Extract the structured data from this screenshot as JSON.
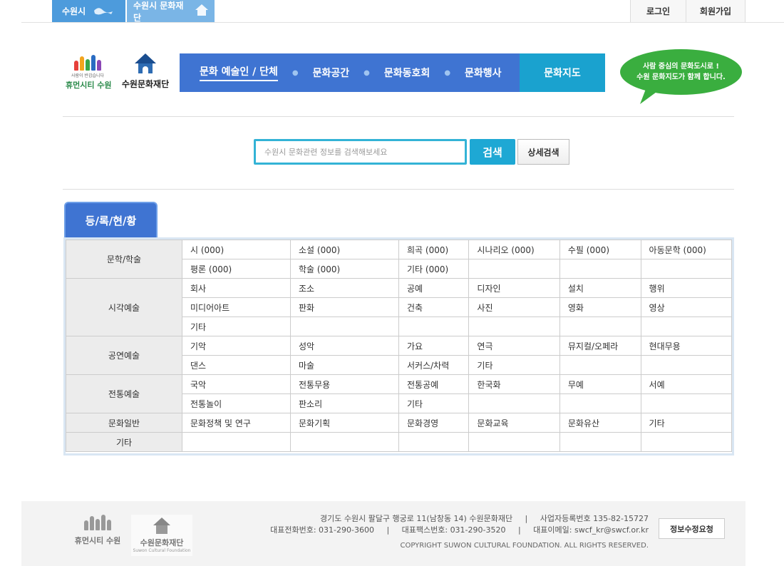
{
  "topbar": {
    "links": [
      {
        "label": "수원시",
        "icon": "map-icon"
      },
      {
        "label": "수원시 문화재단",
        "icon": "home-icon"
      }
    ],
    "login": "로그인",
    "join": "회원가입"
  },
  "header": {
    "logo1": {
      "small": "사람이 반갑습니다",
      "name": "휴먼시티 수원"
    },
    "logo2": {
      "name": "수원문화재단"
    },
    "gnb": [
      {
        "label": "문화 예술인 / 단체"
      },
      {
        "label": "문화공간"
      },
      {
        "label": "문화동호회"
      },
      {
        "label": "문화행사"
      }
    ],
    "map_menu": "문화지도",
    "bubble_line1": "사람 중심의 문화도시로 !",
    "bubble_line2": "수원 문화지도가 함께 합니다."
  },
  "search": {
    "placeholder": "수원시 문화관련 정보를 검색해보세요",
    "value": "",
    "button": "검색",
    "detail_button": "상세검색"
  },
  "registration": {
    "tab": "등/록/현/황",
    "rows": [
      {
        "category": "문학/학술",
        "lines": [
          [
            "시 (000)",
            "소설 (000)",
            "희곡 (000)",
            "시나리오 (000)",
            "수필 (000)",
            "아동문학 (000)"
          ],
          [
            "평론 (000)",
            "학술 (000)",
            "기타 (000)",
            "",
            "",
            ""
          ]
        ]
      },
      {
        "category": "시각예술",
        "lines": [
          [
            "회사",
            "조소",
            "공예",
            "디자인",
            "설치",
            "행위"
          ],
          [
            "미디어아트",
            "판화",
            "건축",
            "사진",
            "영화",
            "영상"
          ],
          [
            "기타",
            "",
            "",
            "",
            "",
            ""
          ]
        ]
      },
      {
        "category": "공연예술",
        "lines": [
          [
            "기악",
            "성악",
            "가요",
            "연극",
            "뮤지컬/오페라",
            "현대무용"
          ],
          [
            "댄스",
            "마술",
            "서커스/차력",
            "기타",
            "",
            ""
          ]
        ]
      },
      {
        "category": "전통예술",
        "lines": [
          [
            "국악",
            "전통무용",
            "전통공예",
            "한국화",
            "무예",
            "서예"
          ],
          [
            "전통놀이",
            "판소리",
            "기타",
            "",
            "",
            ""
          ]
        ]
      },
      {
        "category": "문화일반",
        "lines": [
          [
            "문화정책 및 연구",
            "문화기획",
            "문화경영",
            "문화교육",
            "문화유산",
            "기타"
          ]
        ]
      },
      {
        "category": "기타",
        "lines": [
          [
            "",
            "",
            "",
            "",
            "",
            ""
          ]
        ]
      }
    ]
  },
  "footer": {
    "logo1": "휴먼시티 수원",
    "logo2": "수원문화재단",
    "logo2_en": "Suwon Cultural Foundation",
    "address": "경기도 수원시 팔달구 행궁로 11(남창동 14) 수원문화재단",
    "biz_no": "사업자등록번호 135-82-15727",
    "tel": "대표전화번호: 031-290-3600",
    "fax": "대표팩스번호: 031-290-3520",
    "email": "대표이메일: swcf_kr@swcf.or.kr",
    "copyright": "COPYRIGHT SUWON CULTURAL FOUNDATION. ALL RIGHTS RESERVED.",
    "edit_button": "정보수정요청"
  },
  "colors": {
    "gnb": "#3f74d2",
    "map_menu": "#1aa2cf",
    "bubble": "#3aae3f",
    "search_border": "#33b3d6"
  }
}
